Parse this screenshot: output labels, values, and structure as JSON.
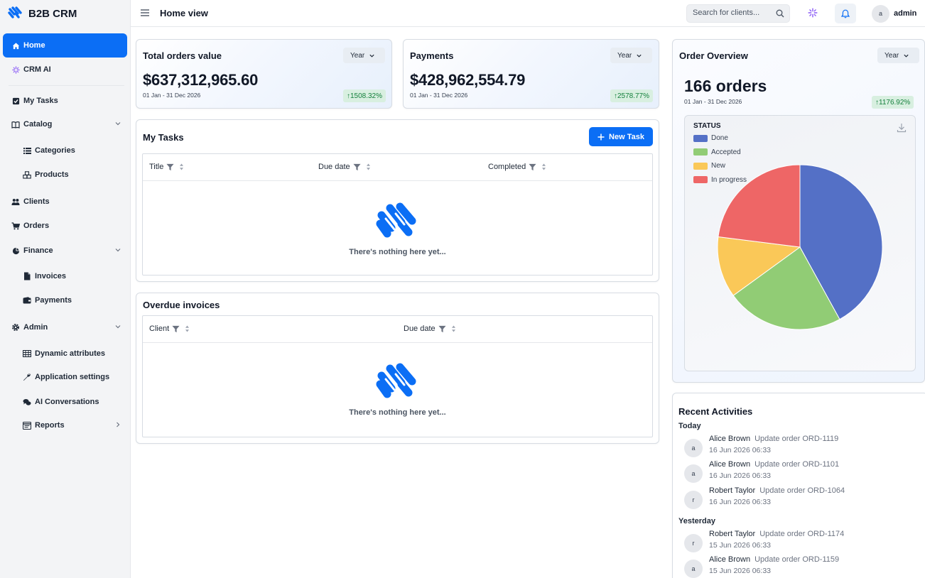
{
  "app": {
    "name": "B2B CRM"
  },
  "sidebar": {
    "items": [
      {
        "label": "Home",
        "icon": "home-icon",
        "active": true
      },
      {
        "label": "CRM AI",
        "icon": "ai-sparkle-icon"
      },
      {
        "label": "My Tasks",
        "icon": "checkbox-icon"
      },
      {
        "label": "Catalog",
        "icon": "book-icon",
        "expandable": true
      },
      {
        "label": "Categories",
        "icon": "list-icon",
        "sub": true
      },
      {
        "label": "Products",
        "icon": "cubes-icon",
        "sub": true
      },
      {
        "label": "Clients",
        "icon": "users-icon"
      },
      {
        "label": "Orders",
        "icon": "cart-icon"
      },
      {
        "label": "Finance",
        "icon": "pie-icon",
        "expandable": true
      },
      {
        "label": "Invoices",
        "icon": "file-icon",
        "sub": true
      },
      {
        "label": "Payments",
        "icon": "wallet-icon",
        "sub": true
      },
      {
        "label": "Admin",
        "icon": "gear-icon",
        "expandable": true
      },
      {
        "label": "Dynamic attributes",
        "icon": "table-icon",
        "sub": true
      },
      {
        "label": "Application settings",
        "icon": "wrench-icon",
        "sub": true
      },
      {
        "label": "AI Conversations",
        "icon": "chat-icon",
        "sub": true
      },
      {
        "label": "Reports",
        "icon": "report-icon",
        "sub": true
      }
    ]
  },
  "topbar": {
    "title": "Home view",
    "search_placeholder": "Search for clients...",
    "user_initial": "a",
    "user_name": "admin"
  },
  "stats": {
    "total_orders": {
      "title": "Total orders value",
      "period": "Year",
      "value": "$637,312,965.60",
      "range": "01 Jan - 31 Dec 2026",
      "change": "↑1508.32%"
    },
    "payments": {
      "title": "Payments",
      "period": "Year",
      "value": "$428,962,554.79",
      "range": "01 Jan - 31 Dec 2026",
      "change": "↑2578.77%"
    }
  },
  "tasks": {
    "title": "My Tasks",
    "new_button": "New Task",
    "columns": [
      "Title",
      "Due date",
      "Completed"
    ],
    "empty": "There's nothing here yet..."
  },
  "overdue": {
    "title": "Overdue invoices",
    "columns": [
      "Client",
      "Due date"
    ],
    "empty": "There's nothing here yet..."
  },
  "overview": {
    "title": "Order Overview",
    "period": "Year",
    "count": "166 orders",
    "range": "01 Jan - 31 Dec 2026",
    "change": "↑1176.92%"
  },
  "chart_data": {
    "type": "pie",
    "title": "STATUS",
    "legend_position": "top-left",
    "categories": [
      "Done",
      "Accepted",
      "New",
      "In progress"
    ],
    "values": [
      42,
      23,
      12,
      23
    ],
    "colors": [
      "#5470c6",
      "#91cc75",
      "#fac858",
      "#ee6666"
    ]
  },
  "activities": {
    "title": "Recent Activities",
    "groups": [
      {
        "label": "Today",
        "items": [
          {
            "initial": "a",
            "user": "Alice Brown",
            "action": "Update order ORD-1119",
            "time": "16 Jun 2026 06:33"
          },
          {
            "initial": "a",
            "user": "Alice Brown",
            "action": "Update order ORD-1101",
            "time": "16 Jun 2026 06:33"
          },
          {
            "initial": "r",
            "user": "Robert Taylor",
            "action": "Update order ORD-1064",
            "time": "16 Jun 2026 06:33"
          }
        ]
      },
      {
        "label": "Yesterday",
        "items": [
          {
            "initial": "r",
            "user": "Robert Taylor",
            "action": "Update order ORD-1174",
            "time": "15 Jun 2026 06:33"
          },
          {
            "initial": "a",
            "user": "Alice Brown",
            "action": "Update order ORD-1159",
            "time": "15 Jun 2026 06:33"
          }
        ]
      }
    ]
  }
}
